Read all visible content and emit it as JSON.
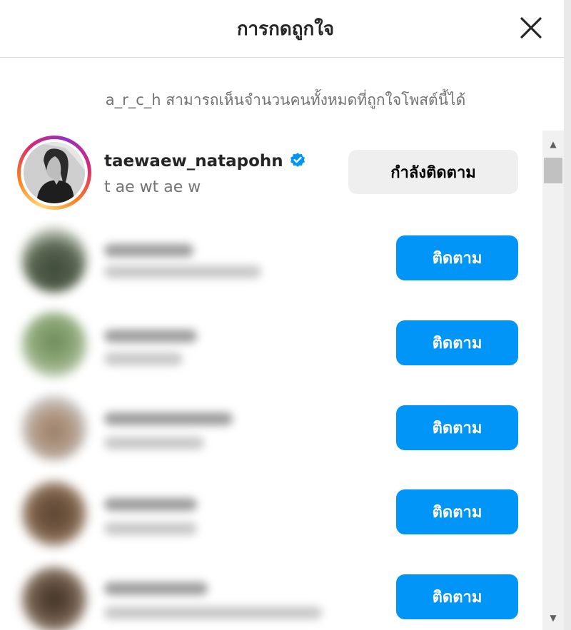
{
  "header": {
    "title": "การกดถูกใจ",
    "close_icon": "close-icon"
  },
  "notice": "a_r_c_h สามารถเห็นจำนวนคนทั้งหมดที่ถูกใจโพสต์นี้ได้",
  "likers": [
    {
      "username": "taewaew_natapohn",
      "verified": true,
      "fullname": "t ae wt ae w",
      "button_label": "กำลังติดตาม",
      "button_state": "following"
    },
    {
      "button_label": "ติดตาม",
      "button_state": "follow",
      "blurred": true
    },
    {
      "button_label": "ติดตาม",
      "button_state": "follow",
      "blurred": true
    },
    {
      "button_label": "ติดตาม",
      "button_state": "follow",
      "blurred": true
    },
    {
      "button_label": "ติดตาม",
      "button_state": "follow",
      "blurred": true
    },
    {
      "button_label": "ติดตาม",
      "button_state": "follow",
      "blurred": true
    }
  ],
  "colors": {
    "follow_button": "#0095f6",
    "following_button": "#efefef",
    "verified_badge": "#0095f6",
    "secondary_text": "#737373"
  }
}
